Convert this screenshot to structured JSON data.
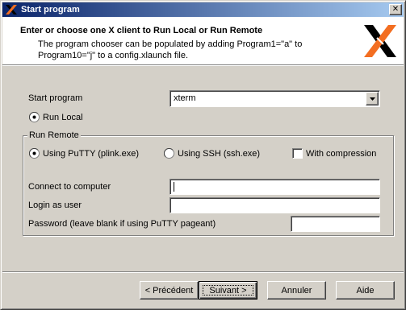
{
  "window": {
    "title": "Start program"
  },
  "header": {
    "title": "Enter or choose one X client to Run Local or Run Remote",
    "subtitle": "The program chooser can be populated by adding Program1=\"a\" to Program10=\"j\" to a config.xlaunch file."
  },
  "form": {
    "start_program_label": "Start program",
    "start_program_value": "xterm",
    "run_local_label": "Run Local",
    "run_local_selected": true,
    "run_remote_legend": "Run Remote",
    "putty_label": "Using PuTTY (plink.exe)",
    "putty_selected": true,
    "ssh_label": "Using SSH (ssh.exe)",
    "ssh_selected": false,
    "compression_label": "With compression",
    "compression_checked": false,
    "connect_label": "Connect to computer",
    "connect_value": "",
    "login_label": "Login as user",
    "login_value": "",
    "password_label": "Password (leave blank if using PuTTY pageant)",
    "password_value": ""
  },
  "buttons": {
    "back": "< Précédent",
    "next": "Suivant >",
    "cancel": "Annuler",
    "help": "Aide"
  },
  "colors": {
    "titlebar_start": "#0a246a",
    "titlebar_end": "#a6caf0",
    "dialog_bg": "#d4d0c8",
    "logo_orange": "#f36e21"
  },
  "icons": {
    "app": "x-logo-small-icon",
    "close": "close-icon",
    "logo": "x-window-system-logo",
    "dropdown": "chevron-down-icon"
  }
}
